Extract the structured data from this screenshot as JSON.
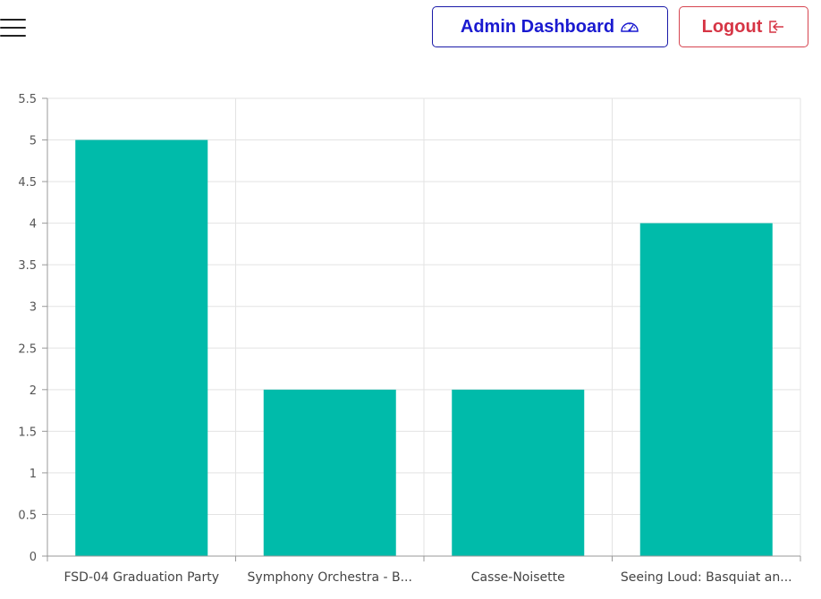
{
  "header": {
    "menu_icon": "hamburger-menu-icon",
    "admin_button": {
      "label": "Admin Dashboard",
      "icon": "speedometer-icon",
      "color": "#1a1ad0"
    },
    "logout_button": {
      "label": "Logout",
      "icon": "logout-icon",
      "color": "#d63545"
    }
  },
  "chart_data": {
    "type": "bar",
    "categories": [
      "FSD-04 Graduation Party",
      "Symphony Orchestra - B...",
      "Casse-Noisette",
      "Seeing Loud: Basquiat an..."
    ],
    "values": [
      5,
      2,
      2,
      4
    ],
    "ylim": [
      0,
      5.5
    ],
    "yticks": [
      "0",
      "0.5",
      "1",
      "1.5",
      "2",
      "2.5",
      "3",
      "3.5",
      "4",
      "4.5",
      "5",
      "5.5"
    ],
    "bar_color": "#00bbaa",
    "grid": true
  }
}
